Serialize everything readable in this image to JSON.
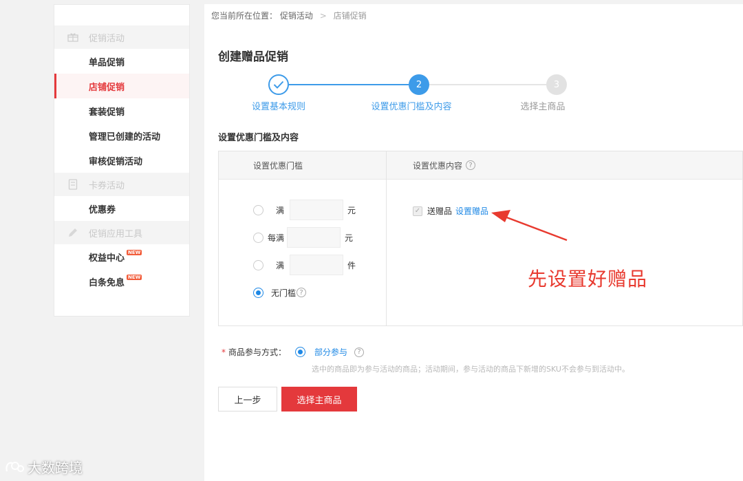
{
  "sidebar": {
    "groups": [
      {
        "label": "促销活动",
        "icon": "gift-box-icon"
      },
      {
        "label": "卡券活动",
        "icon": "coupon-card-icon"
      },
      {
        "label": "促销应用工具",
        "icon": "pencil-icon"
      }
    ],
    "items": [
      {
        "label": "单品促销"
      },
      {
        "label": "店铺促销"
      },
      {
        "label": "套装促销"
      },
      {
        "label": "管理已创建的活动"
      },
      {
        "label": "审核促销活动"
      },
      {
        "label": "优惠券"
      },
      {
        "label": "权益中心",
        "badge": "NEW"
      },
      {
        "label": "白条免息",
        "badge": "NEW"
      }
    ],
    "active_item": "店铺促销"
  },
  "breadcrumb": {
    "prefix": "您当前所在位置：",
    "level1": "促销活动",
    "level2": "店铺促销"
  },
  "page": {
    "title": "创建赠品促销"
  },
  "steps": [
    {
      "number": "",
      "label": "设置基本规则",
      "state": "done"
    },
    {
      "number": "2",
      "label": "设置优惠门槛及内容",
      "state": "current"
    },
    {
      "number": "3",
      "label": "选择主商品",
      "state": "pending"
    }
  ],
  "section": {
    "title": "设置优惠门槛及内容",
    "threshold_header": "设置优惠门槛",
    "content_header": "设置优惠内容",
    "thresholds": [
      {
        "prefix": "满",
        "suffix": "元",
        "selected": false
      },
      {
        "prefix": "每满",
        "suffix": "元",
        "selected": false
      },
      {
        "prefix": "满",
        "suffix": "件",
        "selected": false
      },
      {
        "prefix": "无门槛",
        "suffix": "",
        "selected": true
      }
    ],
    "gift_checkbox_label": "送赠品",
    "gift_link": "设置赠品"
  },
  "annotation": "先设置好赠品",
  "participation": {
    "required_mark": "*",
    "label": "商品参与方式：",
    "option": "部分参与",
    "note": "选中的商品即为参与活动的商品；活动期间，参与活动的商品下新增的SKU不会参与到活动中。"
  },
  "buttons": {
    "prev": "上一步",
    "next": "选择主商品"
  },
  "watermark": "大数跨境",
  "colors": {
    "brand_red": "#e4393c",
    "step_blue": "#3d9be9",
    "link_blue": "#1e88e5",
    "annotation_red": "#e83a2f"
  }
}
